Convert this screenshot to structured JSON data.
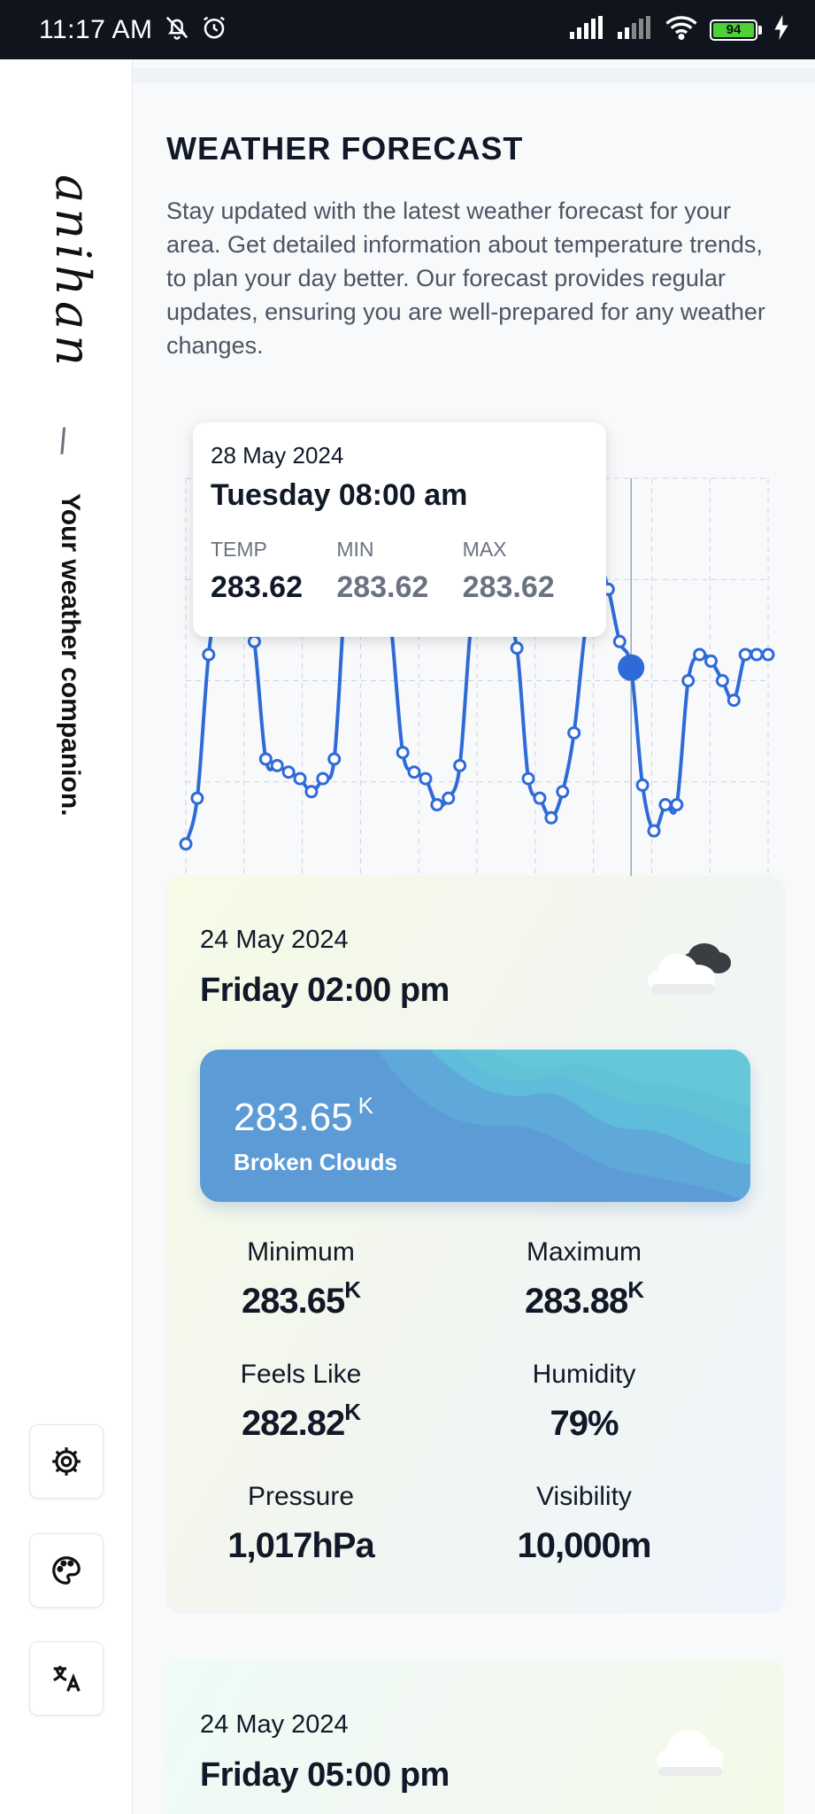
{
  "status_bar": {
    "time": "11:17 AM",
    "battery": "94",
    "icons": [
      "bell-off-icon",
      "alarm-icon",
      "signal-icon",
      "signal-icon",
      "wifi-icon",
      "battery-icon",
      "charging-icon"
    ]
  },
  "sidebar": {
    "brand": "anihan",
    "separator": "/",
    "tagline": "Your weather companion.",
    "buttons": [
      {
        "name": "settings",
        "icon": "settings-gear-icon"
      },
      {
        "name": "theme",
        "icon": "palette-icon"
      },
      {
        "name": "language",
        "icon": "translate-icon"
      }
    ]
  },
  "main": {
    "title": "WEATHER FORECAST",
    "description": "Stay updated with the latest weather forecast for your area. Get detailed information about temperature trends, to plan your day better. Our forecast provides regular updates, ensuring you are well-prepared for any weather changes."
  },
  "tooltip": {
    "date": "28 May 2024",
    "day_time": "Tuesday 08:00 am",
    "temp_label": "TEMP",
    "min_label": "MIN",
    "max_label": "MAX",
    "temp": "283.62",
    "min": "283.62",
    "max": "283.62"
  },
  "chart_data": {
    "type": "line",
    "series": [
      {
        "values": [
          282.6,
          283.3,
          285.5,
          286.5,
          286.8,
          286.5,
          285.7,
          283.9,
          283.8,
          283.7,
          283.6,
          283.4,
          283.6,
          283.9,
          286.5,
          287.5,
          288.0,
          287.2,
          285.9,
          284.0,
          283.7,
          283.6,
          283.2,
          283.3,
          283.8,
          286.0,
          286.8,
          286.5,
          286.0,
          285.6,
          283.6,
          283.3,
          283.0,
          283.4,
          284.3,
          285.9,
          286.9,
          286.5,
          285.7,
          285.3,
          283.5,
          282.8,
          283.2,
          283.2,
          285.1,
          285.5,
          285.4,
          285.1,
          284.8,
          285.5,
          285.5,
          285.5
        ]
      }
    ],
    "highlight_index": 39,
    "grid": true,
    "accent": "#2f6bd8"
  },
  "cards": [
    {
      "date": "24 May 2024",
      "day_time": "Friday 02:00 pm",
      "icon": "broken-clouds-icon",
      "temp": "283.65",
      "unit": "K",
      "description": "Broken Clouds",
      "stats": [
        {
          "label": "Minimum",
          "value": "283.65",
          "unit": "K"
        },
        {
          "label": "Maximum",
          "value": "283.88",
          "unit": "K"
        },
        {
          "label": "Feels Like",
          "value": "282.82",
          "unit": "K"
        },
        {
          "label": "Humidity",
          "value": "79%",
          "unit": ""
        },
        {
          "label": "Pressure",
          "value": "1,017hPa",
          "unit": ""
        },
        {
          "label": "Visibility",
          "value": "10,000m",
          "unit": ""
        }
      ]
    },
    {
      "date": "24 May 2024",
      "day_time": "Friday 05:00 pm",
      "icon": "cloud-icon"
    }
  ]
}
